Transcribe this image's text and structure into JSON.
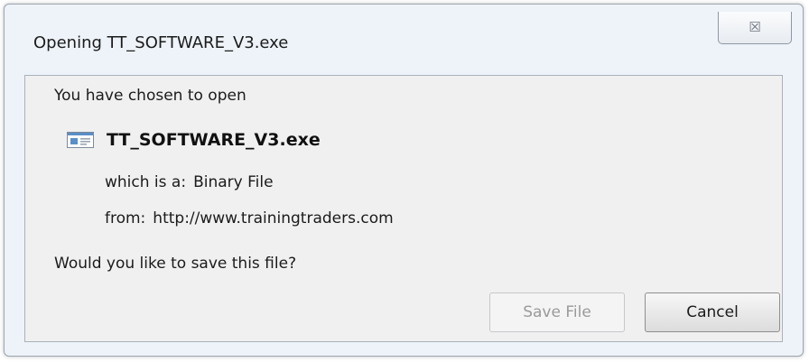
{
  "window": {
    "title": "Opening TT_SOFTWARE_V3.exe",
    "close_glyph": "☒"
  },
  "dialog": {
    "intro": "You have chosen to open",
    "file_name": "TT_SOFTWARE_V3.exe",
    "file_icon": "executable-file-icon",
    "type_label": "which is a:",
    "type_value": "Binary File",
    "from_label": "from:",
    "from_value": "http://www.trainingtraders.com",
    "question": "Would you like to save this file?"
  },
  "buttons": {
    "save_label": "Save File",
    "save_enabled": false,
    "cancel_label": "Cancel"
  },
  "colors": {
    "window_bg": "#eef3f9",
    "content_bg": "#f0f0f0",
    "disabled_text": "#9a9a9a"
  }
}
